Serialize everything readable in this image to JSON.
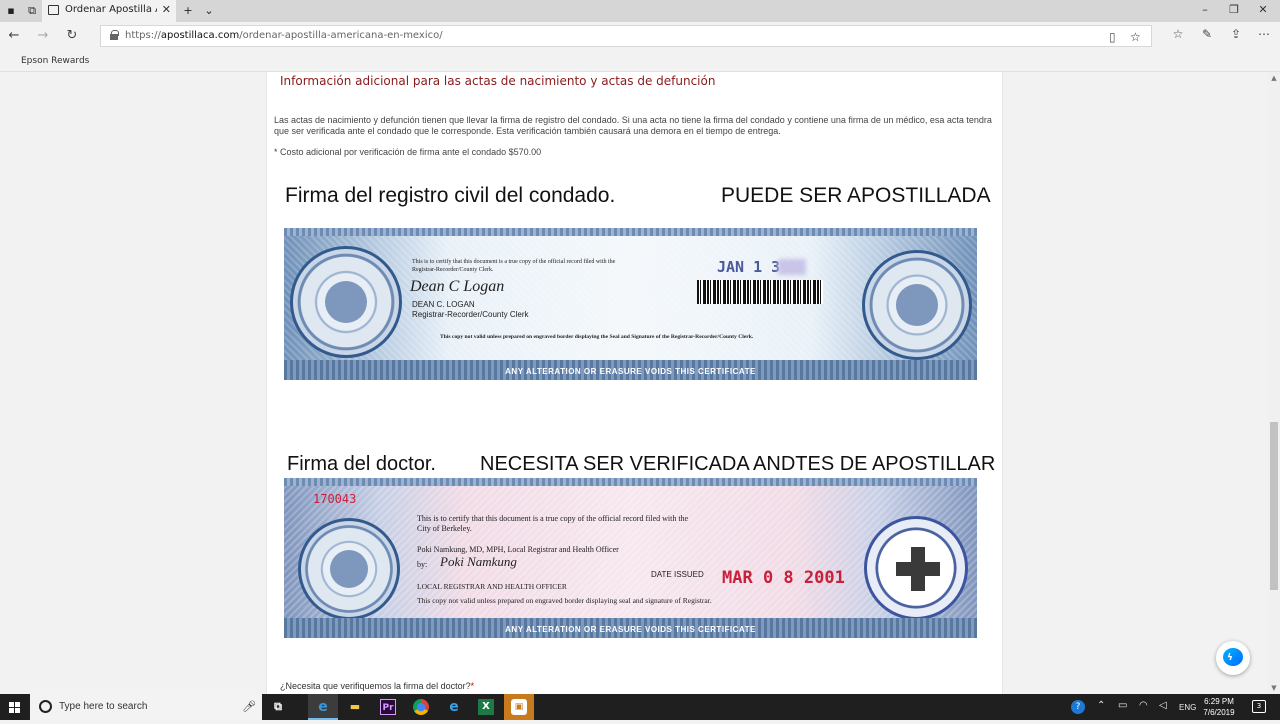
{
  "browser": {
    "tab_title": "Ordenar Apostilla Amer",
    "url_scheme": "https://",
    "url_domain": "apostillaca.com",
    "url_path": "/ordenar-apostilla-americana-en-mexico/",
    "favorites": [
      "Epson Rewards"
    ]
  },
  "page": {
    "heading": "Información adicional para las actas de nacimiento y actas de defunción",
    "paragraph": "Las actas de nacimiento y defunción tienen que llevar la firma de registro del condado. Si una acta no tiene la firma del condado y contiene una firma de un médico, esa acta tendra que ser verificada ante el condado que le corresponde. Esta verificación también causará una demora en el tiempo de entrega.",
    "cost_note": "* Costo adicional por verificación de firma ante el condado  $570.00",
    "image1_caption_left": "Firma del registro civil del condado.",
    "image1_caption_right": "PUEDE SER APOSTILLADA",
    "image2_caption_left": "Firma del doctor.",
    "image2_caption_right": "NECESITA SER VERIFICADA ANDTES DE APOSTILLAR",
    "question": "¿Necesita que verifiquemos la firma del doctor?",
    "required_mark": "*"
  },
  "cert1": {
    "certify": "This is to certify that this document is a true copy of the official record filed with the Registrar-Recorder/County Clerk.",
    "signature": "Dean C Logan",
    "name": "DEAN C. LOGAN",
    "office": "Registrar-Recorder/County Clerk",
    "date_stamp": "JAN 1 3",
    "notice": "This copy not valid unless prepared on engraved border displaying the Seal and Signature of the Registrar-Recorder/County Clerk.",
    "void": "ANY ALTERATION OR ERASURE VOIDS THIS CERTIFICATE"
  },
  "cert2": {
    "number": "170043",
    "certify_1": "This is to certify that this document is a true copy of the official record filed with the",
    "certify_2": "City of Berkeley.",
    "officer": "Poki Namkung, MD, MPH, Local Registrar and Health Officer",
    "by": "by:",
    "signature": "Poki Namkung",
    "title": "LOCAL REGISTRAR AND HEALTH OFFICER",
    "date_label": "DATE ISSUED",
    "date_value": "MAR 0 8 2001",
    "notice": "This copy not valid unless prepared on engraved border displaying seal and signature of Registrar.",
    "void": "ANY ALTERATION OR ERASURE VOIDS THIS CERTIFICATE"
  },
  "taskbar": {
    "search_placeholder": "Type here to search",
    "language": "ENG",
    "time": "6:29 PM",
    "date": "7/6/2019",
    "notification_count": "3"
  }
}
